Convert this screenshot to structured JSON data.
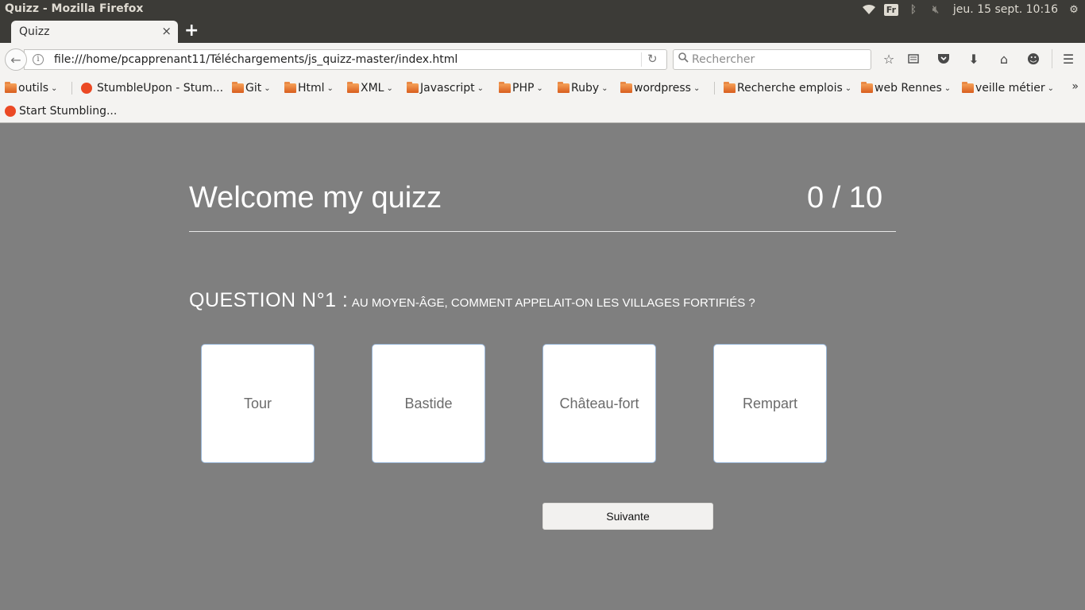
{
  "os": {
    "window_title": "Quizz - Mozilla Firefox",
    "keyboard_layout": "Fr",
    "clock": "jeu. 15 sept. 10:16",
    "indicator_icons": [
      "wifi-icon",
      "bluetooth-icon",
      "volume-muted-icon",
      "power-gear-icon"
    ]
  },
  "browser": {
    "tab_title": "Quizz",
    "tab_close": "×",
    "new_tab": "+",
    "url": "file:///home/pcapprenant11/Téléchargements/js_quizz-master/index.html",
    "search_placeholder": "Rechercher",
    "bookmarks": [
      {
        "label": "outils",
        "type": "folder"
      },
      {
        "label": "StumbleUpon - Stum...",
        "type": "link"
      },
      {
        "label": "Git",
        "type": "folder"
      },
      {
        "label": "Html",
        "type": "folder"
      },
      {
        "label": "XML",
        "type": "folder"
      },
      {
        "label": "Javascript",
        "type": "folder"
      },
      {
        "label": "PHP",
        "type": "folder"
      },
      {
        "label": "Ruby",
        "type": "folder"
      },
      {
        "label": "wordpress",
        "type": "folder"
      },
      {
        "label": "Recherche emplois",
        "type": "folder"
      },
      {
        "label": "web Rennes",
        "type": "folder"
      },
      {
        "label": "veille métier",
        "type": "folder"
      }
    ],
    "bookmarks_more": "»",
    "toolbar2_item": "Start Stumbling..."
  },
  "quiz": {
    "title": "Welcome my quizz",
    "score": "0 / 10",
    "question_label": "QUESTION N°1 :",
    "question_text": "AU MOYEN-ÂGE, COMMENT APPELAIT-ON LES VILLAGES FORTIFIÉS ?",
    "answers": [
      "Tour",
      "Bastide",
      "Château-fort",
      "Rempart"
    ],
    "next_label": "Suivante"
  },
  "colors": {
    "page_background": "#7f7f7f",
    "panel_dark": "#3c3b37",
    "stumbleupon": "#eb4924"
  }
}
